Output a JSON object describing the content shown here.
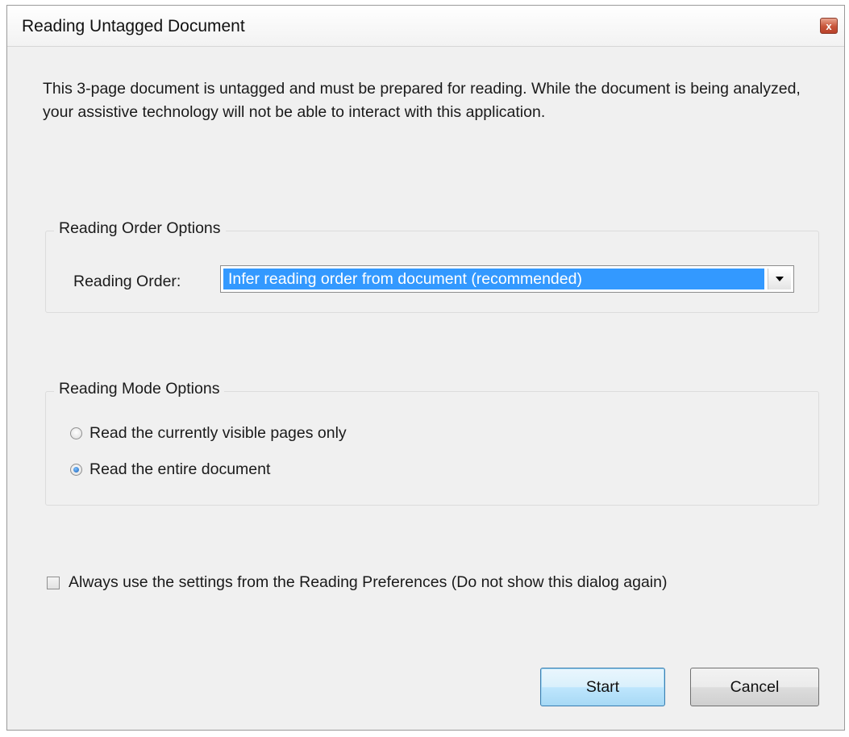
{
  "window": {
    "title": "Reading Untagged Document",
    "close_glyph": "x"
  },
  "intro_text": "This 3-page document is untagged and must be prepared for reading. While the document is being analyzed, your assistive technology will not be able to interact with this application.",
  "reading_order_group": {
    "legend": "Reading Order Options",
    "label": "Reading Order:",
    "selected_value": "Infer reading order from document (recommended)"
  },
  "reading_mode_group": {
    "legend": "Reading Mode Options",
    "options": [
      {
        "label": "Read the currently visible pages only",
        "selected": false
      },
      {
        "label": "Read the entire document",
        "selected": true
      }
    ]
  },
  "preferences_checkbox": {
    "label": "Always use the settings from the Reading Preferences (Do not show this dialog again)",
    "checked": false
  },
  "buttons": {
    "start": "Start",
    "cancel": "Cancel"
  },
  "colors": {
    "selection_highlight": "#3399ff",
    "dialog_background": "#f0f0f0",
    "default_button": "#bee6fd",
    "close_button": "#c8553a"
  }
}
